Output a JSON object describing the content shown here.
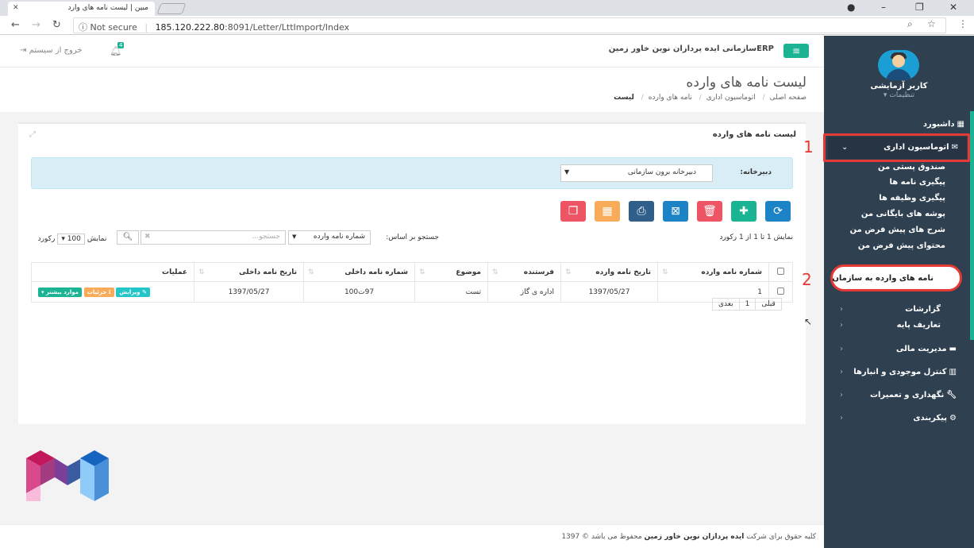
{
  "browser": {
    "tab_title": "مبین | لیست نامه های وارد",
    "not_secure": "Not secure",
    "url_host": "185.120.222.80",
    "url_rest": ":8091/Letter/LttImport/Index"
  },
  "topbar": {
    "brand": "ERPسازمانی ایده پردازان نوین خاور زمین",
    "logout": "خروج از سیستم",
    "bell_count": "4"
  },
  "page": {
    "title": "لیست نامه های وارده",
    "breadcrumb": [
      "صفحه اصلی",
      "اتوماسیون اداری",
      "نامه های وارده",
      "لیست"
    ]
  },
  "panel": {
    "title": "لیست نامه های وارده",
    "filter_label": "دبیرخانه:",
    "filter_value": "دبیرخانه برون سازمانی"
  },
  "toolbar": {
    "colors": [
      "#1c84c6",
      "#1ab394",
      "#ed5565",
      "#1c84c6",
      "#2f5f8a",
      "#f8ac59",
      "#ed5565"
    ]
  },
  "table_controls": {
    "info": "نمایش 1 تا 1 از 1 رکورد",
    "search_by": "جستجو بر اساس:",
    "search_field": "شماره نامه وارده",
    "search_placeholder": "جستجو...",
    "show": "نمایش",
    "page_size": "100",
    "records": "رکورد"
  },
  "table": {
    "headers": [
      "شماره نامه وارده",
      "تاریخ نامه وارده",
      "فرستنده",
      "موضوع",
      "شماره نامه داخلی",
      "تاریخ نامه داخلی",
      "عملیات"
    ],
    "rows": [
      {
        "no": "1",
        "date": "1397/05/27",
        "sender": "اداره ی گاز",
        "subject": "تست",
        "internal_no": "97ت100",
        "internal_date": "1397/05/27"
      }
    ],
    "actions": {
      "edit": "ویرایش",
      "details": "جزئیات",
      "more": "موارد بیشتر"
    }
  },
  "pager": {
    "prev": "قبلی",
    "page": "1",
    "next": "بعدی"
  },
  "sidebar": {
    "user": "کاربر آزمایشی",
    "settings": "تنظیمات",
    "dashboard": "داشبورد",
    "office": "اتوماسیون اداری",
    "submenu": [
      "صندوق پستی من",
      "پیگیری نامه ها",
      "پیگیری وظیفه ها",
      "پوشه های بایگانی من",
      "شرح های پیش فرض من",
      "محتوای پیش فرض من"
    ],
    "incoming_org": "نامه های وارده به سازمان",
    "reports": "گزارشات",
    "base_defs": "تعاریف پایه",
    "finance": "مدیریت مالی",
    "inventory": "کنترل موجودی و انبارها",
    "maintenance": "نگهداری و تعمیرات",
    "config": "پیکربندی"
  },
  "annotations": {
    "one": "1",
    "two": "2"
  },
  "footer": {
    "pre": "کلیه حقوق برای شرکت ",
    "company": "ایده پردازان نوین خاور زمین",
    "post": " محفوظ می باشد © 1397"
  }
}
